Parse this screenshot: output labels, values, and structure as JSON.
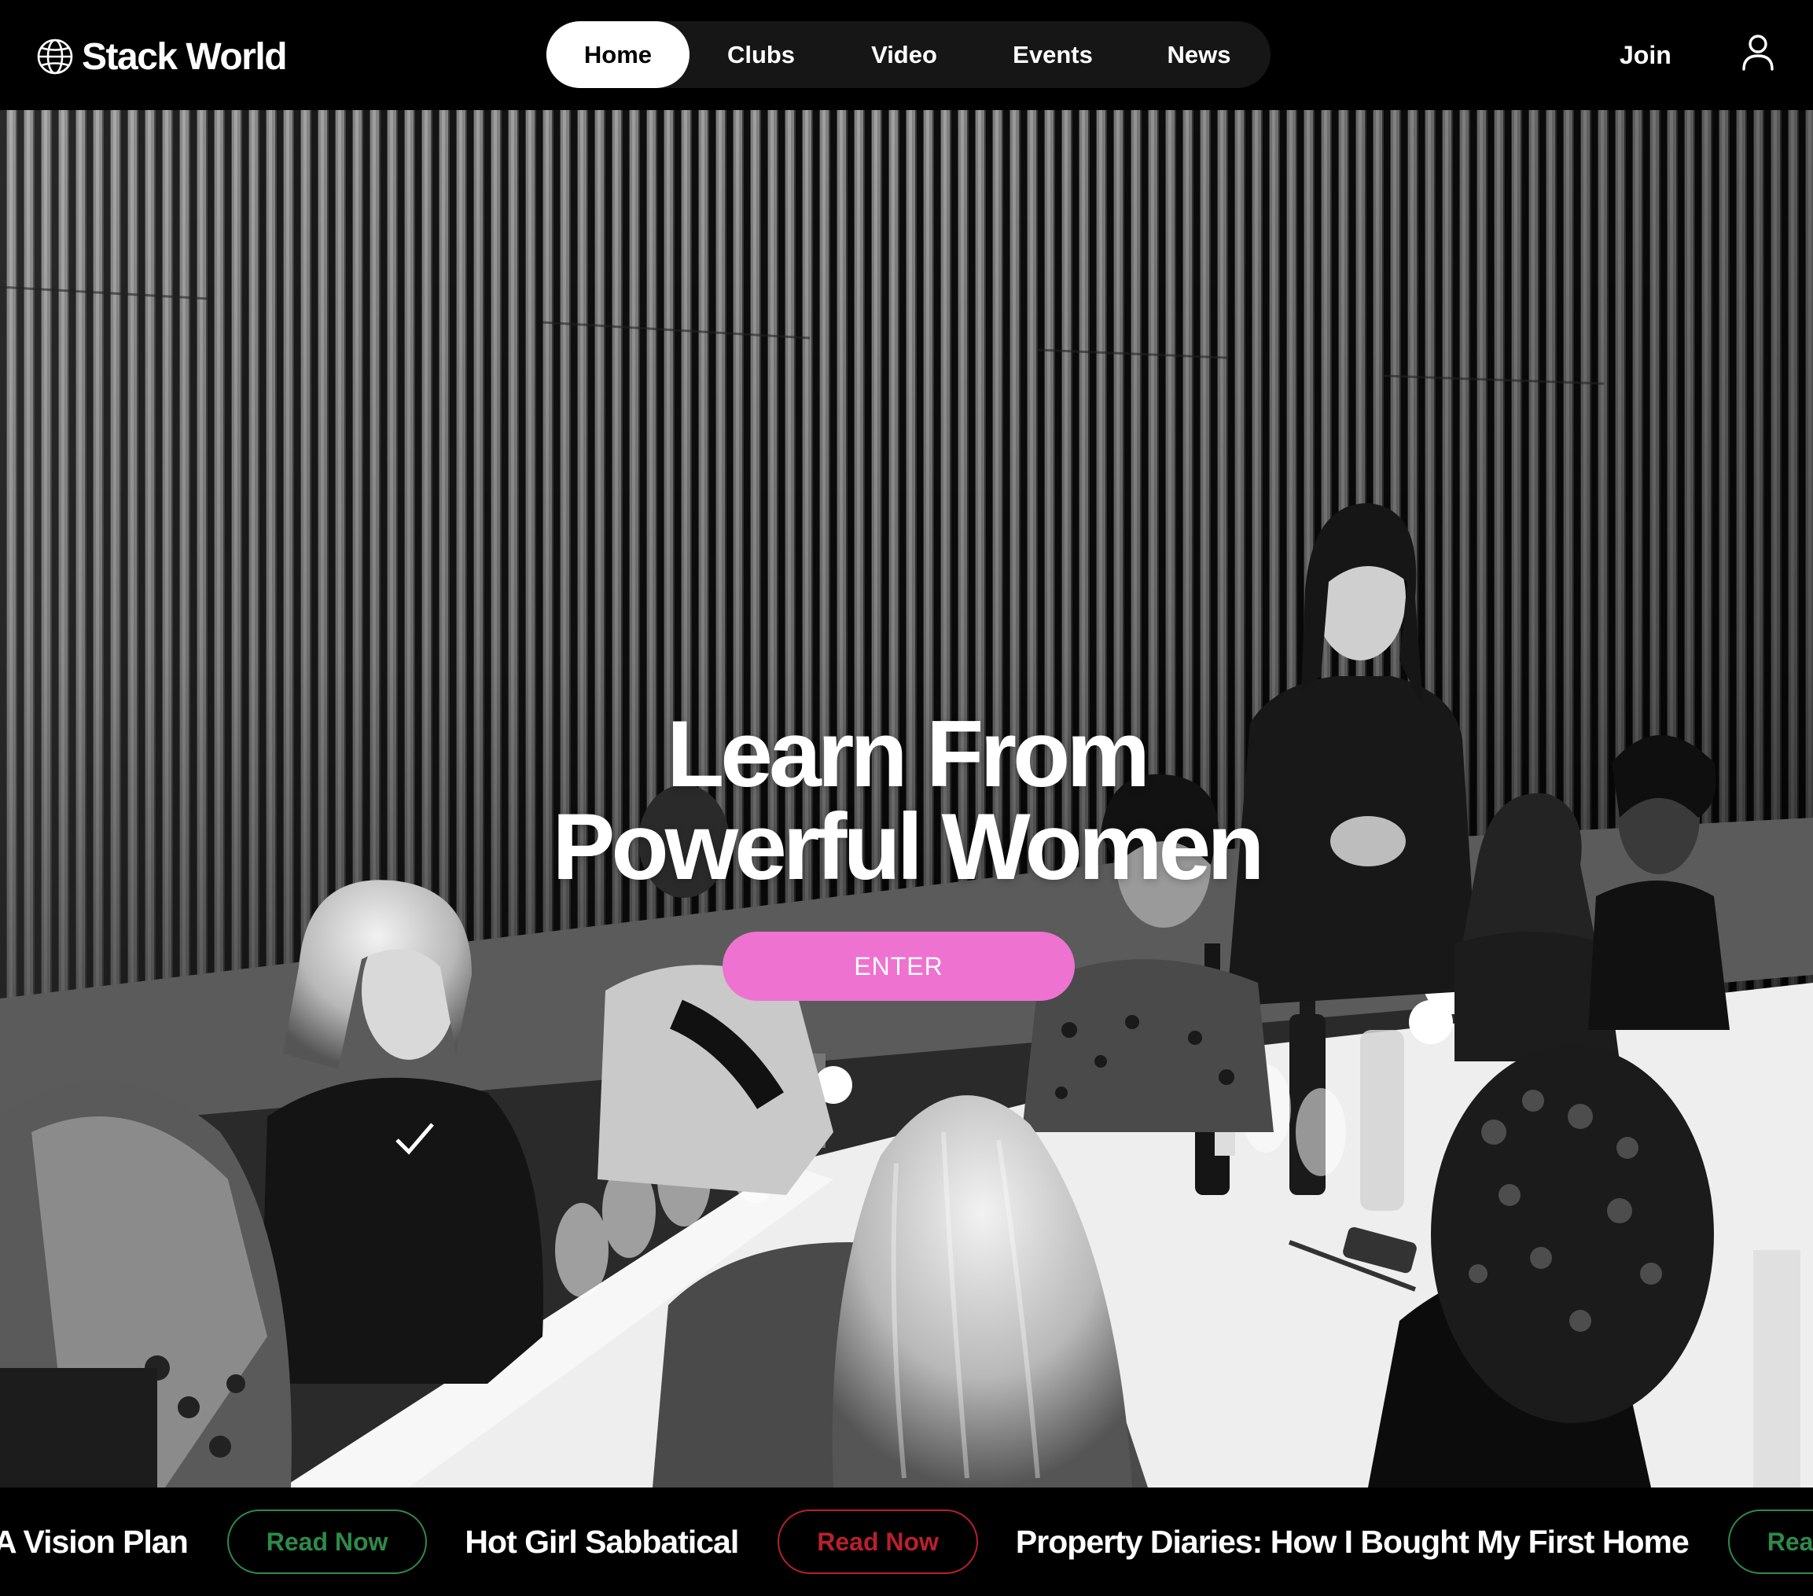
{
  "brand": {
    "name": "Stack World"
  },
  "nav": {
    "items": [
      {
        "label": "Home",
        "active": true
      },
      {
        "label": "Clubs",
        "active": false
      },
      {
        "label": "Video",
        "active": false
      },
      {
        "label": "Events",
        "active": false
      },
      {
        "label": "News",
        "active": false
      }
    ]
  },
  "header": {
    "join_label": "Join",
    "user_icon": "user-icon"
  },
  "hero": {
    "title_line1": "Learn From",
    "title_line2": "Powerful Women",
    "cta_label": "ENTER",
    "cta_color": "#ee72d0"
  },
  "ticker": {
    "items": [
      {
        "title": "A Vision Plan",
        "button_label": "Read Now",
        "button_color": "#2e8a4a"
      },
      {
        "title": "Hot Girl Sabbatical",
        "button_label": "Read Now",
        "button_color": "#b8202c"
      },
      {
        "title": "Property Diaries: How I Bought My First Home",
        "button_label": "Read Now",
        "button_color": "#2e8a4a"
      }
    ]
  }
}
